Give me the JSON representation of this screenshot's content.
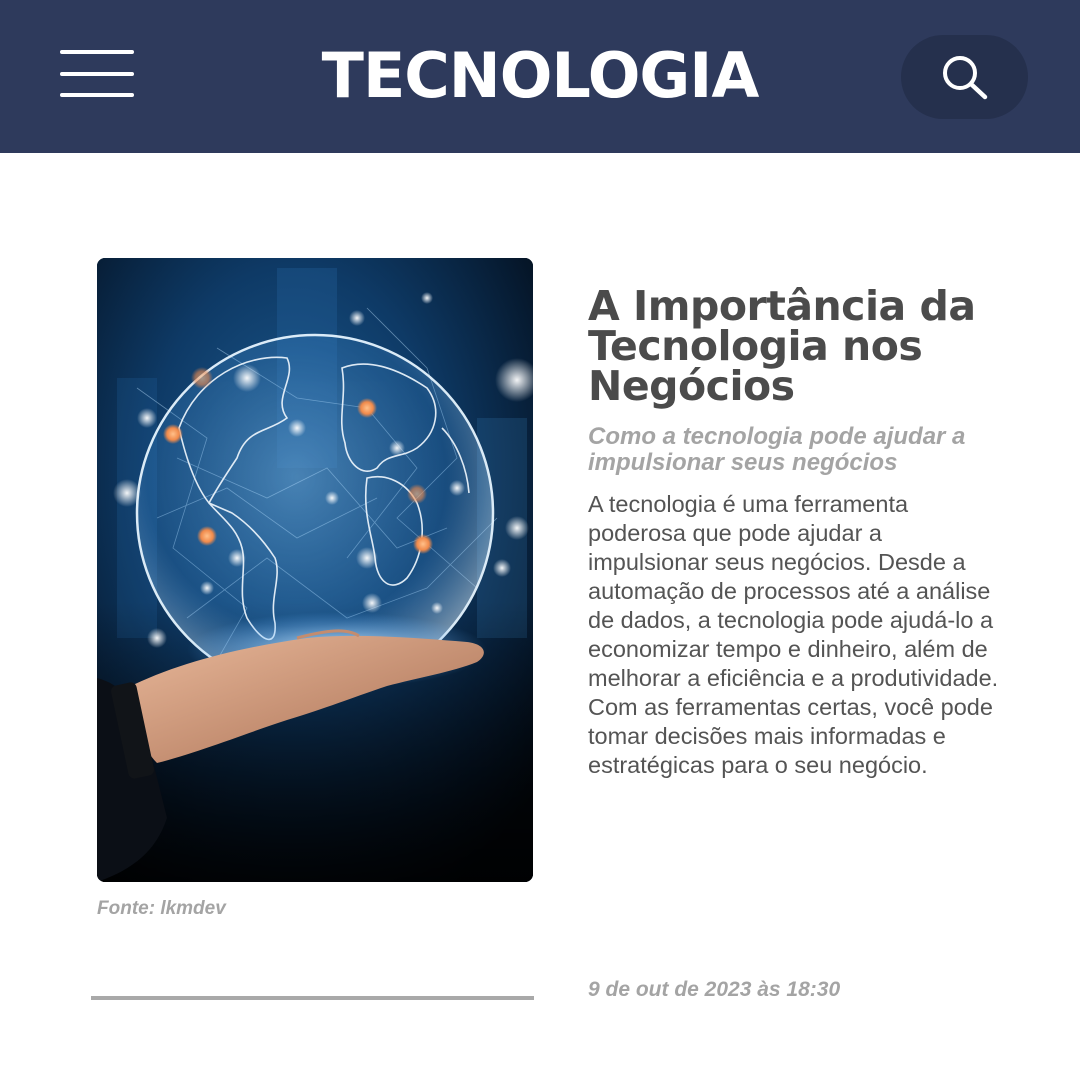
{
  "header": {
    "title": "TECNOLOGIA",
    "menu_icon": "hamburger-menu-icon",
    "search_icon": "search-icon",
    "background_color": "#2e3a5c",
    "search_button_color": "#25304d"
  },
  "article": {
    "title": "A Importância da Tecnologia nos Negócios",
    "subtitle": "Como a tecnologia pode ajudar a impulsionar seus negócios",
    "body": "A tecnologia é uma ferramenta poderosa que pode ajudar a impulsionar seus negócios. Desde a automação de processos até a análise de dados, a tecnologia pode ajudá-lo a economizar tempo e dinheiro, além de melhorar a eficiência e a produtividade. Com as ferramentas certas, você pode tomar decisões mais informadas e estratégicas para o seu negócio.",
    "image_caption": "Fonte: lkmdev",
    "date": "9 de out de 2023 às 18:30",
    "title_color": "#4b4b4b",
    "muted_color": "#a4a4a4"
  }
}
